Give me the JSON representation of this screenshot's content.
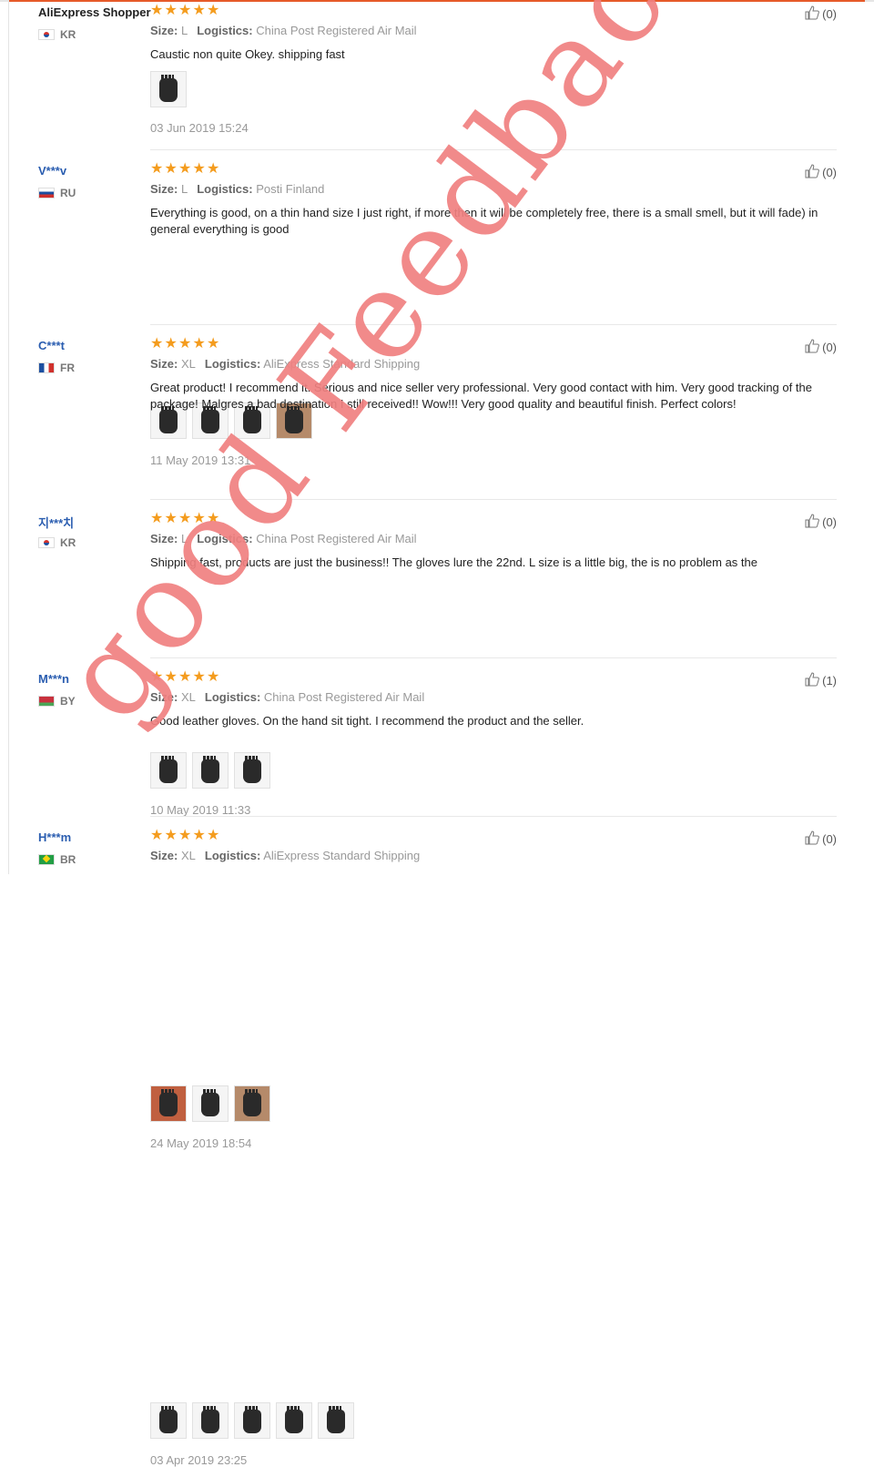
{
  "labels": {
    "size": "Size:",
    "logistics": "Logistics:"
  },
  "colors": {
    "star": "#f49c1e",
    "username": "#2a5db0",
    "watermark": "#f08080",
    "topbar_accent": "#e65a2a"
  },
  "watermark": {
    "text": "good Feedback"
  },
  "reviews": [
    {
      "user": "AliExpress Shopper",
      "country": "KR",
      "flag": "kr",
      "stars": 5,
      "size": "L",
      "logistics": "China Post Registered Air Mail",
      "text": "Caustic non quite Okey. shipping fast",
      "photos": 1,
      "date": "03 Jun 2019 15:24",
      "helpful": "(0)"
    },
    {
      "user": "V***v",
      "country": "RU",
      "flag": "ru",
      "stars": 5,
      "size": "L",
      "logistics": "Posti Finland",
      "text": "Everything is good, on a thin hand size I just right, if more then it will be completely free, there is a small smell, but it will fade) in general everything is good",
      "photos": 4,
      "date": "11 May 2019 13:31",
      "helpful": "(0)"
    },
    {
      "user": "C***t",
      "country": "FR",
      "flag": "fr",
      "stars": 5,
      "size": "XL",
      "logistics": "AliExpress Standard Shipping",
      "text": "Great product! I recommend it. Serious and nice seller very professional. Very good contact with him. Very good tracking of the package! Malgres a bad destination I still received!! Wow!!! Very good quality and beautiful finish. Perfect colors!",
      "photos": 3,
      "date": "10 May 2019 11:33",
      "helpful": "(0)"
    },
    {
      "user": "지***치",
      "country": "KR",
      "flag": "kr",
      "stars": 5,
      "size": "L",
      "logistics": "China Post Registered Air Mail",
      "text": "Shipping fast, products are just the business!! The gloves lure the 22nd. L size is a little big, the is no problem as the",
      "photos": 3,
      "date": "24 May 2019 18:54",
      "helpful": "(0)"
    },
    {
      "user": "M***n",
      "country": "BY",
      "flag": "by",
      "stars": 5,
      "size": "XL",
      "logistics": "China Post Registered Air Mail",
      "text": "Good leather gloves. On the hand sit tight. I recommend the product and the seller.",
      "photos": 5,
      "date": "03 Apr 2019 23:25",
      "helpful": "(1)"
    },
    {
      "user": "H***m",
      "country": "BR",
      "flag": "br",
      "stars": 5,
      "size": "XL",
      "logistics": "AliExpress Standard Shipping",
      "text": "",
      "photos": 0,
      "date": "",
      "helpful": "(0)"
    }
  ]
}
